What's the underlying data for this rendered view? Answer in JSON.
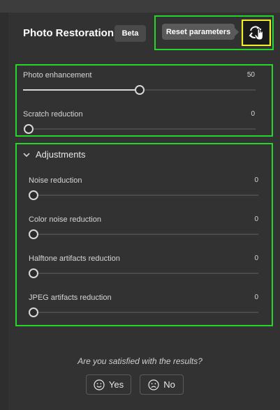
{
  "panel": {
    "title": "Photo Restoration",
    "badge": "Beta"
  },
  "tooltip": "Reset parameters",
  "reset_icon": "reset-parameters-icon",
  "main_sliders": [
    {
      "label": "Photo enhancement",
      "value": "50",
      "level": 0.5
    },
    {
      "label": "Scratch reduction",
      "value": "0",
      "level": 0
    }
  ],
  "adjustments": {
    "title": "Adjustments",
    "expanded": true,
    "sliders": [
      {
        "label": "Noise reduction",
        "value": "0",
        "level": 0
      },
      {
        "label": "Color noise reduction",
        "value": "0",
        "level": 0
      },
      {
        "label": "Halftone artifacts reduction",
        "value": "0",
        "level": 0
      },
      {
        "label": "JPEG artifacts reduction",
        "value": "0",
        "level": 0
      }
    ]
  },
  "feedback": {
    "question": "Are you satisfied with the results?",
    "yes": "Yes",
    "no": "No"
  },
  "colors": {
    "highlight_green": "#27d52a",
    "highlight_yellow": "#f4f023",
    "panel_bg": "#323232"
  }
}
